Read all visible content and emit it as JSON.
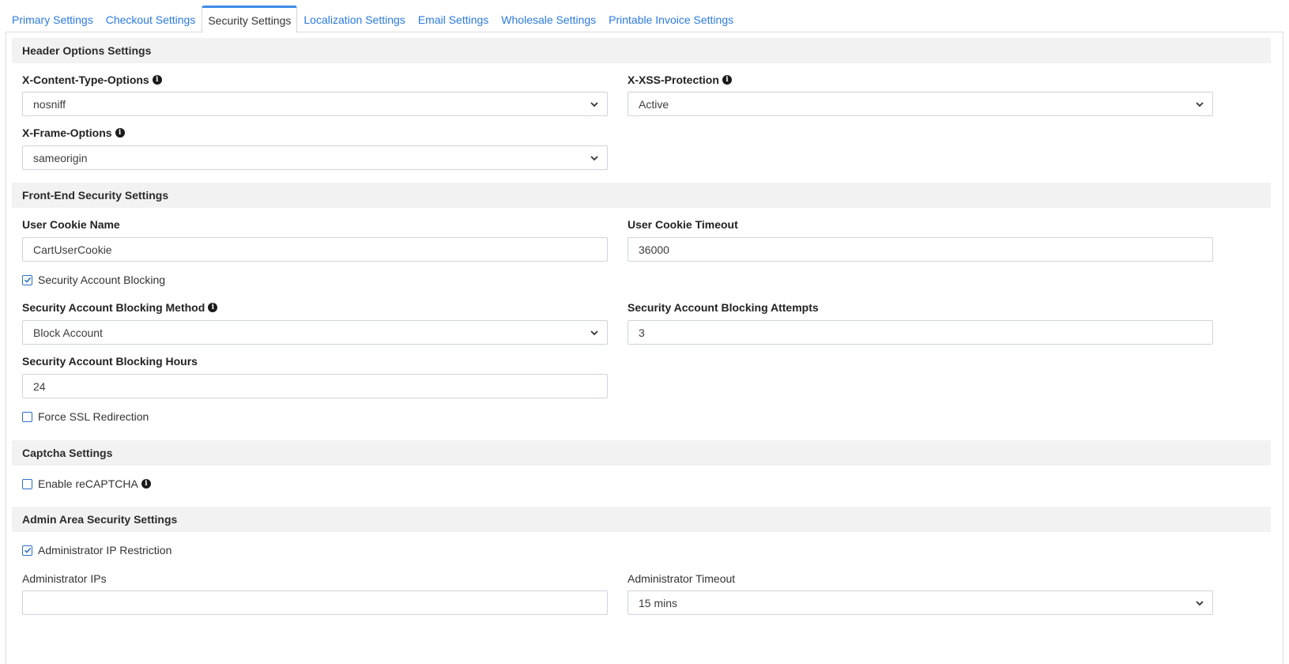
{
  "tabs": [
    {
      "label": "Primary Settings"
    },
    {
      "label": "Checkout Settings"
    },
    {
      "label": "Security Settings"
    },
    {
      "label": "Localization Settings"
    },
    {
      "label": "Email Settings"
    },
    {
      "label": "Wholesale Settings"
    },
    {
      "label": "Printable Invoice Settings"
    }
  ],
  "sections": {
    "header_options": {
      "title": "Header Options Settings",
      "content_type": {
        "label": "X-Content-Type-Options",
        "value": "nosniff"
      },
      "xss": {
        "label": "X-XSS-Protection",
        "value": "Active"
      },
      "frame": {
        "label": "X-Frame-Options",
        "value": "sameorigin"
      }
    },
    "frontend": {
      "title": "Front-End Security Settings",
      "cookie_name": {
        "label": "User Cookie Name",
        "value": "CartUserCookie"
      },
      "cookie_timeout": {
        "label": "User Cookie Timeout",
        "value": "36000"
      },
      "account_blocking": {
        "label": "Security Account Blocking",
        "checked": true
      },
      "blocking_method": {
        "label": "Security Account Blocking Method",
        "value": "Block Account"
      },
      "blocking_attempts": {
        "label": "Security Account Blocking Attempts",
        "value": "3"
      },
      "blocking_hours": {
        "label": "Security Account Blocking Hours",
        "value": "24"
      },
      "force_ssl": {
        "label": "Force SSL Redirection",
        "checked": false
      }
    },
    "captcha": {
      "title": "Captcha Settings",
      "recaptcha": {
        "label": "Enable reCAPTCHA",
        "checked": false
      }
    },
    "admin": {
      "title": "Admin Area Security Settings",
      "ip_restriction": {
        "label": "Administrator IP Restriction",
        "checked": true
      },
      "admin_ips": {
        "label": "Administrator IPs",
        "value": ""
      },
      "admin_timeout": {
        "label": "Administrator Timeout",
        "value": "15 mins"
      }
    }
  },
  "colors": {
    "link": "#2a7ae2",
    "active_tab_border": "#3d8be6",
    "section_bg": "#f2f2f2",
    "checkbox": "#2a6fc7"
  },
  "icons": {
    "info": "info-circle-icon",
    "dropdown": "chevron-down-icon",
    "check": "checkmark-icon"
  }
}
